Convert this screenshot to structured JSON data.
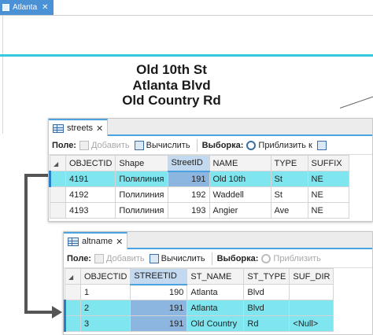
{
  "map": {
    "tab_label": "Atlanta",
    "labels": [
      "Old 10th St",
      "Atlanta Blvd",
      "Old Country Rd"
    ]
  },
  "streets": {
    "tab_label": "streets",
    "toolbar": {
      "field_label": "Поле:",
      "add_label": "Добавить",
      "calc_label": "Вычислить",
      "selection_label": "Выборка:",
      "zoom_label": "Приблизить к"
    },
    "columns": [
      "OBJECTID",
      "Shape",
      "StreetID",
      "NAME",
      "TYPE",
      "SUFFIX"
    ],
    "rows": [
      {
        "objectid": "4191",
        "shape": "Полилиния",
        "streetid": "191",
        "name": "Old 10th",
        "type": "St",
        "suffix": "NE"
      },
      {
        "objectid": "4192",
        "shape": "Полилиния",
        "streetid": "192",
        "name": "Waddell",
        "type": "St",
        "suffix": "NE"
      },
      {
        "objectid": "4193",
        "shape": "Полилиния",
        "streetid": "193",
        "name": "Angier",
        "type": "Ave",
        "suffix": "NE"
      }
    ]
  },
  "altname": {
    "tab_label": "altname",
    "toolbar": {
      "field_label": "Поле:",
      "add_label": "Добавить",
      "calc_label": "Вычислить",
      "selection_label": "Выборка:",
      "zoom_label": "Приблизить"
    },
    "columns": [
      "OBJECTID",
      "STREETID",
      "ST_NAME",
      "ST_TYPE",
      "SUF_DIR"
    ],
    "rows": [
      {
        "objectid": "1",
        "streetid": "190",
        "st_name": "Atlanta",
        "st_type": "Blvd",
        "suf_dir": ""
      },
      {
        "objectid": "2",
        "streetid": "191",
        "st_name": "Atlanta",
        "st_type": "Blvd",
        "suf_dir": ""
      },
      {
        "objectid": "3",
        "streetid": "191",
        "st_name": "Old Country",
        "st_type": "Rd",
        "suf_dir": "<Null>"
      }
    ]
  },
  "colors": {
    "highlight": "#7fe6f0",
    "accent": "#4aa3df",
    "map_line": "#35c8e0"
  }
}
